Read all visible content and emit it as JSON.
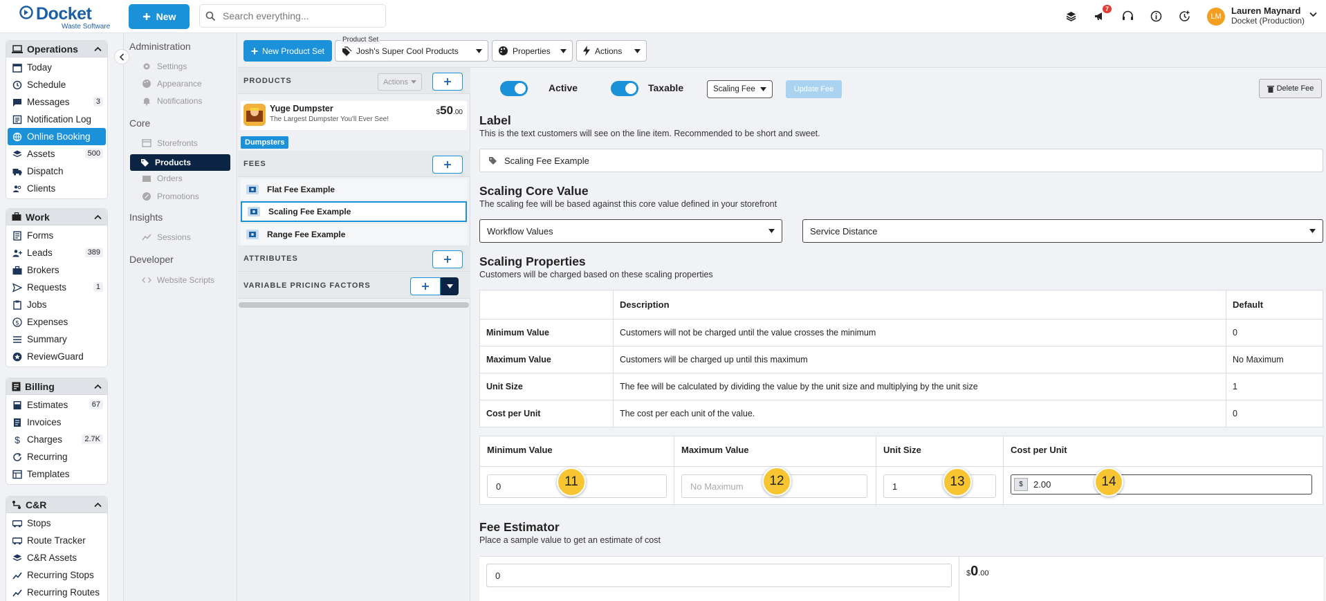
{
  "brand": {
    "name": "Docket",
    "sub": "Waste Software",
    "accent": "#1a91d9",
    "navy": "#0c2444"
  },
  "topbar": {
    "new_label": "New",
    "search_placeholder": "Search everything...",
    "notifications_count": "7",
    "user": {
      "initials": "LM",
      "name": "Lauren Maynard",
      "org": "Docket (Production)"
    }
  },
  "nav": {
    "operations": {
      "title": "Operations",
      "items": [
        {
          "label": "Today",
          "icon": "calendar-icon"
        },
        {
          "label": "Schedule",
          "icon": "clock-icon"
        },
        {
          "label": "Messages",
          "icon": "chat-icon",
          "count": "3"
        },
        {
          "label": "Notification Log",
          "icon": "log-icon"
        },
        {
          "label": "Online Booking",
          "icon": "globe-icon"
        },
        {
          "label": "Assets",
          "icon": "layers-icon",
          "count": "500"
        },
        {
          "label": "Dispatch",
          "icon": "truck-icon"
        },
        {
          "label": "Clients",
          "icon": "people-icon"
        }
      ]
    },
    "work": {
      "title": "Work",
      "items": [
        {
          "label": "Forms",
          "icon": "form-icon"
        },
        {
          "label": "Leads",
          "icon": "person-plus-icon",
          "count": "389"
        },
        {
          "label": "Brokers",
          "icon": "briefcase-icon"
        },
        {
          "label": "Requests",
          "icon": "send-icon",
          "count": "1"
        },
        {
          "label": "Jobs",
          "icon": "clipboard-icon"
        },
        {
          "label": "Expenses",
          "icon": "dollar-circle-icon"
        },
        {
          "label": "Summary",
          "icon": "list-icon"
        },
        {
          "label": "ReviewGuard",
          "icon": "star-icon"
        }
      ]
    },
    "billing": {
      "title": "Billing",
      "items": [
        {
          "label": "Estimates",
          "icon": "calc-icon",
          "count": "67"
        },
        {
          "label": "Invoices",
          "icon": "invoice-icon"
        },
        {
          "label": "Charges",
          "icon": "dollar-icon",
          "count": "2.7K"
        },
        {
          "label": "Recurring",
          "icon": "refresh-icon"
        },
        {
          "label": "Templates",
          "icon": "template-icon"
        }
      ]
    },
    "cr": {
      "title": "C&R",
      "items": [
        {
          "label": "Stops",
          "icon": "bus-icon"
        },
        {
          "label": "Route Tracker",
          "icon": "bus-icon"
        },
        {
          "label": "C&R Assets",
          "icon": "layers-icon"
        },
        {
          "label": "Recurring Stops",
          "icon": "trend-icon"
        },
        {
          "label": "Recurring Routes",
          "icon": "trend-icon"
        }
      ]
    }
  },
  "settings": {
    "administration": "Administration",
    "admin_items": [
      "Settings",
      "Appearance",
      "Notifications"
    ],
    "core": "Core",
    "core_items": [
      "Storefronts",
      "Products",
      "Orders",
      "Promotions"
    ],
    "insights": "Insights",
    "insights_items": [
      "Sessions"
    ],
    "developer": "Developer",
    "developer_items": [
      "Website Scripts"
    ]
  },
  "toolbar": {
    "new_product_set": "New Product Set",
    "product_set_label": "Product Set",
    "product_set_value": "Josh's Super Cool Products",
    "properties": "Properties",
    "actions": "Actions"
  },
  "products_panel": {
    "products_header": "PRODUCTS",
    "actions_label": "Actions",
    "product": {
      "name": "Yuge Dumpster",
      "desc": "The Largest Dumpster You'll Ever See!",
      "price_symbol": "$",
      "price_whole": "50",
      "price_cents": ".00",
      "tag": "Dumpsters"
    },
    "fees_header": "FEES",
    "fees": [
      "Flat Fee Example",
      "Scaling Fee Example",
      "Range Fee Example"
    ],
    "attributes_header": "ATTRIBUTES",
    "vpf_header": "VARIABLE PRICING FACTORS"
  },
  "fee_editor": {
    "active_label": "Active",
    "taxable_label": "Taxable",
    "fee_type": "Scaling Fee",
    "update_label": "Update Fee",
    "delete_label": "Delete Fee",
    "label_title": "Label",
    "label_desc": "This is the text customers will see on the line item. Recommended to be short and sweet.",
    "label_value": "Scaling Fee Example",
    "core_title": "Scaling Core Value",
    "core_desc": "The scaling fee will be based against this core value defined in your storefront",
    "core_select_1": "Workflow Values",
    "core_select_2": "Service Distance",
    "props_title": "Scaling Properties",
    "props_desc": "Customers will be charged based on these scaling properties",
    "table_headers": [
      "",
      "Description",
      "Default"
    ],
    "table_rows": [
      [
        "Minimum Value",
        "Customers will not be charged until the value crosses the minimum",
        "0"
      ],
      [
        "Maximum Value",
        "Customers will be charged up until this maximum",
        "No Maximum"
      ],
      [
        "Unit Size",
        "The fee will be calculated by dividing the value by the unit size and multiplying by the unit size",
        "1"
      ],
      [
        "Cost per Unit",
        "The cost per each unit of the value.",
        "0"
      ]
    ],
    "inputs": {
      "min_label": "Minimum Value",
      "min_value": "0",
      "max_label": "Maximum Value",
      "max_placeholder": "No Maximum",
      "unit_label": "Unit Size",
      "unit_value": "1",
      "cost_label": "Cost per Unit",
      "cost_prefix": "$",
      "cost_value": "2.00"
    },
    "markers": [
      "11",
      "12",
      "13",
      "14"
    ],
    "estimator_title": "Fee Estimator",
    "estimator_desc": "Place a sample value to get an estimate of cost",
    "estimator_value": "0",
    "estimate_symbol": "$",
    "estimate_whole": "0",
    "estimate_cents": ".00"
  }
}
